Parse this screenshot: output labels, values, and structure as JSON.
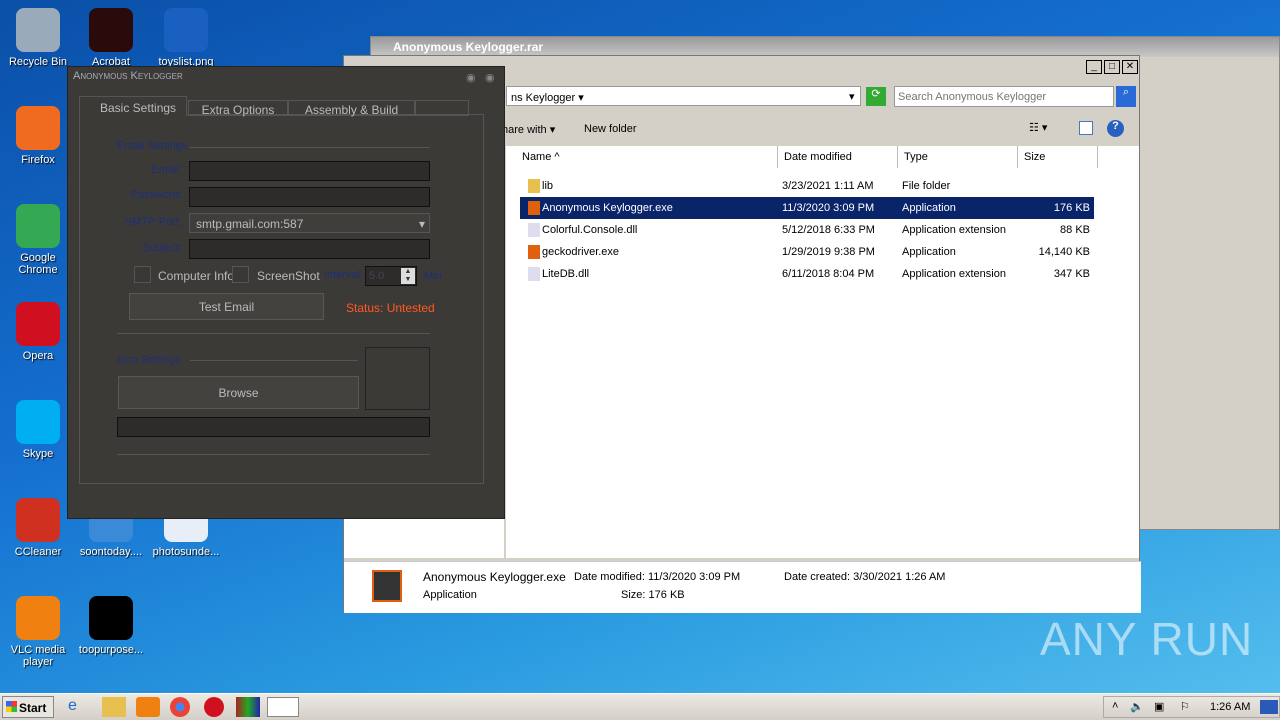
{
  "desktop": {
    "icons": [
      {
        "label": "Recycle Bin",
        "color": "#9ab"
      },
      {
        "label": "Acrobat",
        "color": "#2a0a0a"
      },
      {
        "label": "toyslist.png",
        "color": "#1a60c0"
      },
      {
        "label": "Firefox",
        "color": "#f06a20"
      },
      {
        "label": "Google Chrome",
        "color": "#34a853"
      },
      {
        "label": "Opera",
        "color": "#d01020"
      },
      {
        "label": "Skype",
        "color": "#00aff0"
      },
      {
        "label": "CCleaner",
        "color": "#d03020"
      },
      {
        "label": "soontoday....",
        "color": "#3a8ad8"
      },
      {
        "label": "photosunde...",
        "color": "#e8eef8"
      },
      {
        "label": "VLC media player",
        "color": "#f08010"
      },
      {
        "label": "toopurpose...",
        "color": "#000000"
      }
    ]
  },
  "rar": {
    "title": "Anonymous Keylogger.rar"
  },
  "explorer": {
    "address": "ns Keylogger",
    "search_placeholder": "Search Anonymous Keylogger",
    "toolbar": {
      "share": "hare with",
      "new_folder": "New folder"
    },
    "columns": [
      "Name",
      "Date modified",
      "Type",
      "Size"
    ],
    "files": [
      {
        "name": "lib",
        "date": "3/23/2021 1:11 AM",
        "type": "File folder",
        "size": "",
        "icon": "folder-icon"
      },
      {
        "name": "Anonymous Keylogger.exe",
        "date": "11/3/2020 3:09 PM",
        "type": "Application",
        "size": "176 KB",
        "icon": "exe-icon",
        "selected": true
      },
      {
        "name": "Colorful.Console.dll",
        "date": "5/12/2018 6:33 PM",
        "type": "Application extension",
        "size": "88 KB",
        "icon": "dll-icon"
      },
      {
        "name": "geckodriver.exe",
        "date": "1/29/2019 9:38 PM",
        "type": "Application",
        "size": "14,140 KB",
        "icon": "exe-icon"
      },
      {
        "name": "LiteDB.dll",
        "date": "6/11/2018 8:04 PM",
        "type": "Application extension",
        "size": "347 KB",
        "icon": "dll-icon"
      }
    ],
    "details": {
      "name": "Anonymous Keylogger.exe",
      "type": "Application",
      "modified_label": "Date modified:",
      "modified": "11/3/2020 3:09 PM",
      "size_label": "Size:",
      "size": "176 KB",
      "created_label": "Date created:",
      "created": "3/30/2021 1:26 AM"
    }
  },
  "keylogger": {
    "title": "Anonymous Keylogger",
    "tabs": [
      "Basic Settings",
      "Extra Options",
      "Assembly & Build"
    ],
    "email_group": "Email Settings",
    "email_label": "Email:",
    "password_label": "Password:",
    "smtp_label": "SMTP-Port:",
    "smtp_value": "smtp.gmail.com:587",
    "subject_label": "Subject:",
    "computer_info": "Computer Info",
    "screenshot": "ScreenShot",
    "interval_label": "Interval:",
    "interval_value": "5.0",
    "min_label": "Min",
    "test_email": "Test Email",
    "status": "Status: Untested",
    "status_color": "#ff5a1e",
    "icon_group": "Icon Settings",
    "browse": "Browse"
  },
  "taskbar": {
    "start": "Start",
    "clock": "1:26 AM"
  },
  "watermark": "ANY RUN"
}
